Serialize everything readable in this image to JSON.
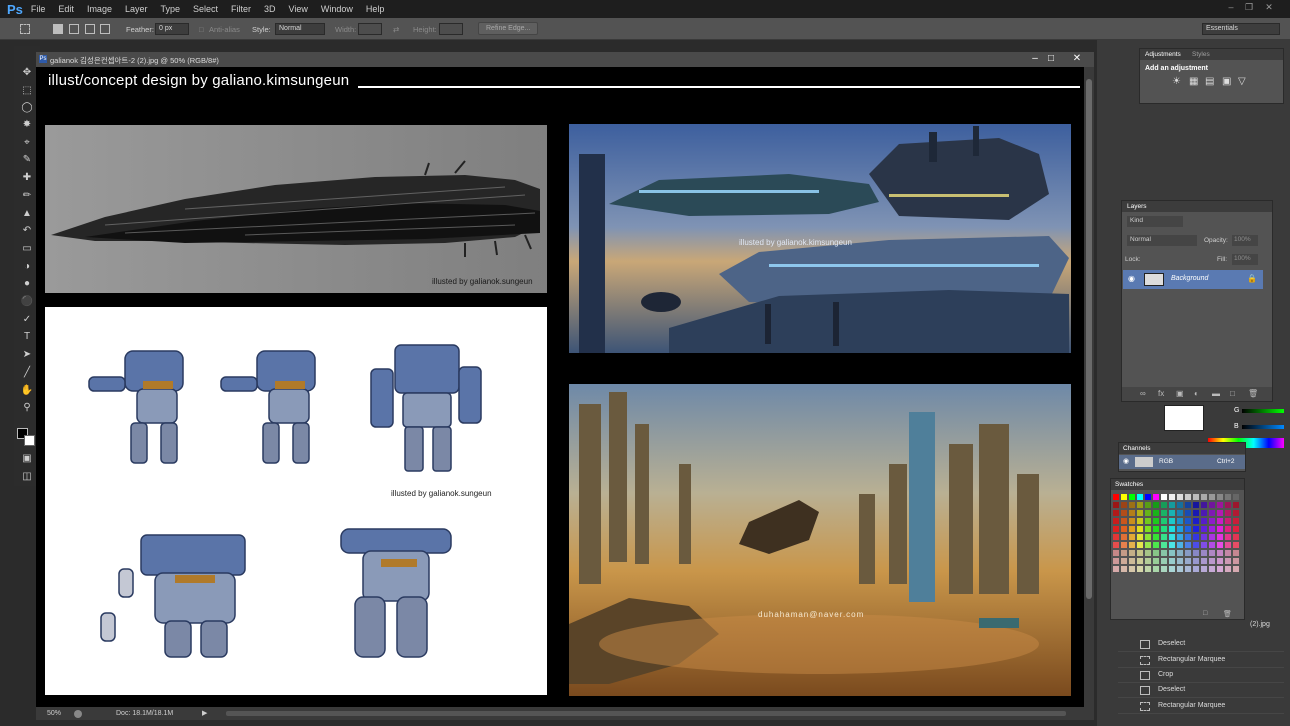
{
  "app": {
    "logo": "Ps",
    "menu": [
      "File",
      "Edit",
      "Image",
      "Layer",
      "Type",
      "Select",
      "Filter",
      "3D",
      "View",
      "Window",
      "Help"
    ],
    "workspace": "Essentials"
  },
  "options_bar": {
    "feather_label": "Feather:",
    "feather_value": "0 px",
    "anti_alias_label": "Anti-alias",
    "style_label": "Style:",
    "style_value": "Normal",
    "width_label": "Width:",
    "height_label": "Height:",
    "refine_edge_label": "Refine Edge..."
  },
  "document": {
    "tab_title": "galianok 김성은컨셉아트-2 (2).jpg @ 50% (RGB/8#)",
    "heading": "illust/concept design by galiano.kimsungeun",
    "credit_ship_sketch": "illusted by galianok.sungeun",
    "credit_ship_watermark": "illusted by galianok.sungeun",
    "credit_scene_watermark": "illusted by galianok.kimsungeun",
    "credit_mechs": "illusted by galianok.sungeun",
    "credit_desert": "duhahaman@naver.com"
  },
  "status": {
    "zoom": "50%",
    "doc_size": "Doc: 18.1M/18.1M"
  },
  "adjustments_panel": {
    "tab_adjustments": "Adjustments",
    "tab_styles": "Styles",
    "add_label": "Add an adjustment"
  },
  "layers_panel": {
    "title": "Layers",
    "filter_kind": "Kind",
    "blend_mode": "Normal",
    "opacity_label": "Opacity:",
    "opacity_value": "100%",
    "lock_label": "Lock:",
    "fill_label": "Fill:",
    "fill_value": "100%",
    "layer_name": "Background"
  },
  "color_panel": {
    "g_label": "G",
    "b_label": "B"
  },
  "channels_panel": {
    "title": "Channels",
    "channel_name": "RGB",
    "shortcut": "Ctrl+2"
  },
  "swatches_panel": {
    "title": "Swatches"
  },
  "history_panel": {
    "file_label": "(2).jpg",
    "items": [
      "Deselect",
      "Rectangular Marquee",
      "Crop",
      "Deselect",
      "Rectangular Marquee"
    ]
  }
}
